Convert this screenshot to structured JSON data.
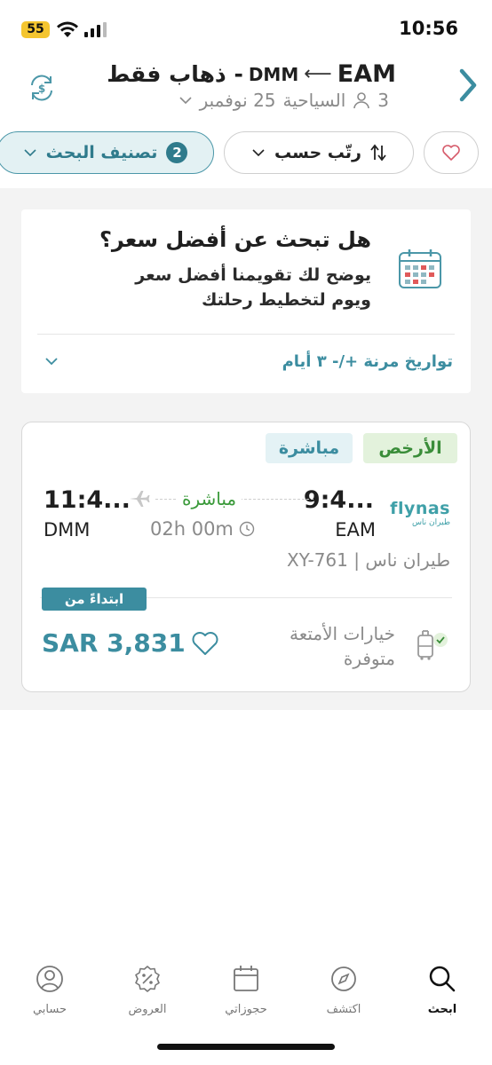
{
  "status_bar": {
    "battery": "55",
    "time": "10:56"
  },
  "header": {
    "origin": "EAM",
    "destination": "DMM",
    "trip_type": "- ذهاب فقط",
    "passengers": "3",
    "cabin": "السياحية",
    "date": "25 نوفمبر"
  },
  "filters": {
    "classify_label": "تصنيف البحث",
    "classify_count": "2",
    "sort_label": "رتّب حسب"
  },
  "promo": {
    "title": "هل تبحث عن أفضل سعر؟",
    "text": "يوضح لك تقويمنا أفضل سعر ويوم لتخطيط رحلتك",
    "flex_label": "تواريخ مرنة +/- ٣ أيام"
  },
  "flight": {
    "tag_cheapest": "الأرخص",
    "tag_direct": "مباشرة",
    "airline_logo_en": "flynas",
    "airline_logo_ar": "طيران ناس",
    "departure_time": "9:4...",
    "departure_code": "EAM",
    "arrival_time": "11:4...",
    "arrival_code": "DMM",
    "stops": "مباشرة",
    "duration": "02h 00m",
    "flight_number": "طيران ناس | XY-761",
    "from_label": "ابتداءً من",
    "price": "SAR 3,831",
    "baggage": "خيارات الأمتعة متوفرة"
  },
  "tabbar": {
    "items": [
      {
        "label": "ابحث",
        "icon": "search-icon"
      },
      {
        "label": "اكتشف",
        "icon": "compass-icon"
      },
      {
        "label": "حجوزاتي",
        "icon": "calendar-icon"
      },
      {
        "label": "العروض",
        "icon": "discount-icon"
      },
      {
        "label": "حسابي",
        "icon": "user-icon"
      }
    ]
  },
  "colors": {
    "accent": "#3c8da0",
    "green": "#3a8d39"
  }
}
